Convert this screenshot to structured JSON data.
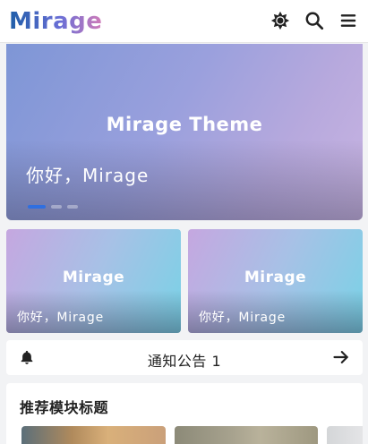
{
  "header": {
    "logo": "Mirage",
    "icons": [
      "theme-toggle-icon",
      "search-icon",
      "menu-icon"
    ]
  },
  "banner": {
    "theme_title": "Mirage Theme",
    "caption": "你好，Mirage",
    "slide_count": 3,
    "active_slide": 1
  },
  "cards": [
    {
      "brand": "Mirage",
      "caption": "你好，Mirage"
    },
    {
      "brand": "Mirage",
      "caption": "你好，Mirage"
    }
  ],
  "notice": {
    "text": "通知公告 1"
  },
  "recommend": {
    "title": "推荐模块标题"
  },
  "colors": {
    "accent": "#2f6fe0",
    "background": "#f2f3f5"
  }
}
